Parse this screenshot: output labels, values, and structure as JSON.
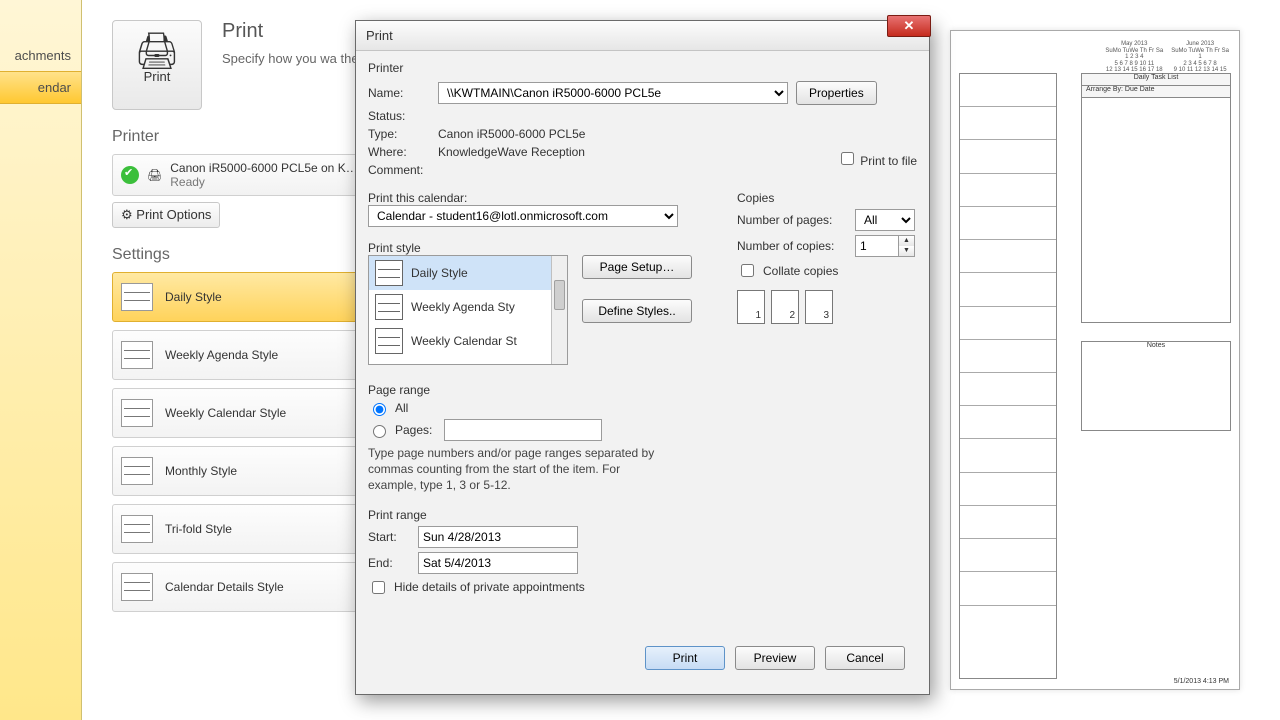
{
  "backstage": {
    "items": [
      "achments",
      "endar"
    ],
    "selected_index": 1
  },
  "pane": {
    "title": "Print",
    "subtitle": "Specify how you wa\nthen click Print.",
    "print_button": "Print",
    "printer_heading": "Printer",
    "printer_name": "Canon iR5000-6000 PCL5e on K…",
    "printer_status": "Ready",
    "print_options": "Print Options",
    "settings_heading": "Settings",
    "styles": [
      "Daily Style",
      "Weekly Agenda Style",
      "Weekly Calendar Style",
      "Monthly Style",
      "Tri-fold Style",
      "Calendar Details Style"
    ],
    "selected_style_index": 0
  },
  "dialog": {
    "title": "Print",
    "printer_section": "Printer",
    "name_label": "Name:",
    "name_value": "\\\\KWTMAIN\\Canon iR5000-6000 PCL5e",
    "properties_button": "Properties",
    "status_label": "Status:",
    "type_label": "Type:",
    "type_value": "Canon iR5000-6000 PCL5e",
    "where_label": "Where:",
    "where_value": "KnowledgeWave Reception",
    "comment_label": "Comment:",
    "print_to_file": "Print to file",
    "print_calendar_label": "Print this calendar:",
    "calendar_value": "Calendar - student16@lotl.onmicrosoft.com",
    "print_style_label": "Print style",
    "style_list": [
      "Daily Style",
      "Weekly Agenda Sty",
      "Weekly Calendar St"
    ],
    "page_setup_button": "Page Setup…",
    "define_styles_button": "Define Styles..",
    "copies_section": "Copies",
    "num_pages_label": "Number of pages:",
    "num_pages_value": "All",
    "num_copies_label": "Number of copies:",
    "num_copies_value": "1",
    "collate_label": "Collate copies",
    "page_range_label": "Page range",
    "pr_all": "All",
    "pr_pages": "Pages:",
    "pr_hint": "Type page numbers and/or page ranges separated by commas counting from the start of the item.  For example, type 1, 3 or 5-12.",
    "print_range_label": "Print range",
    "start_label": "Start:",
    "start_value": "Sun 4/28/2013",
    "end_label": "End:",
    "end_value": "Sat 5/4/2013",
    "hide_private": "Hide details of private appointments",
    "print_btn": "Print",
    "preview_btn": "Preview",
    "cancel_btn": "Cancel"
  },
  "preview": {
    "month1": "May 2013",
    "month1_days": "SuMo TuWe Th Fr Sa",
    "month2": "June 2013",
    "month2_days": "SuMo TuWe Th Fr Sa",
    "tasklist_title": "Daily Task List",
    "arrange_by": "Arrange By: Due Date",
    "notes_title": "Notes",
    "footer": "5/1/2013 4:13 PM"
  }
}
